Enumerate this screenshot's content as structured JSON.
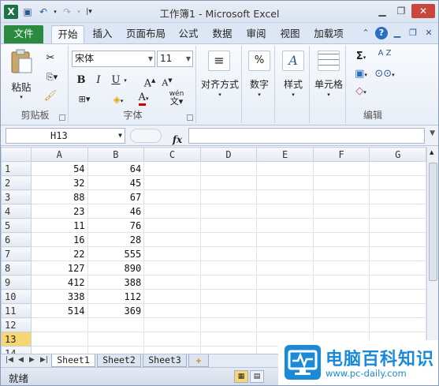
{
  "window": {
    "title": "工作簿1 - Microsoft Excel"
  },
  "qat": {
    "logo": "X",
    "save": "💾",
    "undo": "↶",
    "redo": "↷"
  },
  "tabs": [
    "文件",
    "开始",
    "插入",
    "页面布局",
    "公式",
    "数据",
    "审阅",
    "视图",
    "加载项"
  ],
  "ribbon": {
    "clipboard": {
      "paste": "粘贴",
      "label": "剪贴板"
    },
    "font": {
      "name": "宋体",
      "size": "11",
      "bold": "B",
      "italic": "I",
      "underline": "U",
      "grow": "A",
      "shrink": "A",
      "fontcolor": "A",
      "wen": "wén",
      "label": "字体"
    },
    "alignment": {
      "label": "对齐方式",
      "icon": "≡"
    },
    "number": {
      "label": "数字",
      "icon": "%"
    },
    "styles": {
      "label": "样式",
      "icon": "A"
    },
    "cells": {
      "label": "单元格"
    },
    "editing": {
      "label": "编辑",
      "sigma": "Σ",
      "sort": "A Z",
      "find": "A"
    }
  },
  "formula": {
    "namebox": "H13",
    "fx": "fx",
    "value": ""
  },
  "columns": [
    "A",
    "B",
    "C",
    "D",
    "E",
    "F",
    "G"
  ],
  "rows": [
    {
      "n": "1",
      "a": "54",
      "b": "64"
    },
    {
      "n": "2",
      "a": "32",
      "b": "45"
    },
    {
      "n": "3",
      "a": "88",
      "b": "67"
    },
    {
      "n": "4",
      "a": "23",
      "b": "46"
    },
    {
      "n": "5",
      "a": "11",
      "b": "76"
    },
    {
      "n": "6",
      "a": "16",
      "b": "28"
    },
    {
      "n": "7",
      "a": "22",
      "b": "555"
    },
    {
      "n": "8",
      "a": "127",
      "b": "890"
    },
    {
      "n": "9",
      "a": "412",
      "b": "388"
    },
    {
      "n": "10",
      "a": "338",
      "b": "112"
    },
    {
      "n": "11",
      "a": "514",
      "b": "369"
    },
    {
      "n": "12",
      "a": "",
      "b": ""
    },
    {
      "n": "13",
      "a": "",
      "b": ""
    },
    {
      "n": "14",
      "a": "",
      "b": ""
    }
  ],
  "sheets": [
    "Sheet1",
    "Sheet2",
    "Sheet3"
  ],
  "status": {
    "text": "就绪"
  },
  "watermark": {
    "title": "电脑百科知识",
    "url": "www.pc-daily.com"
  }
}
